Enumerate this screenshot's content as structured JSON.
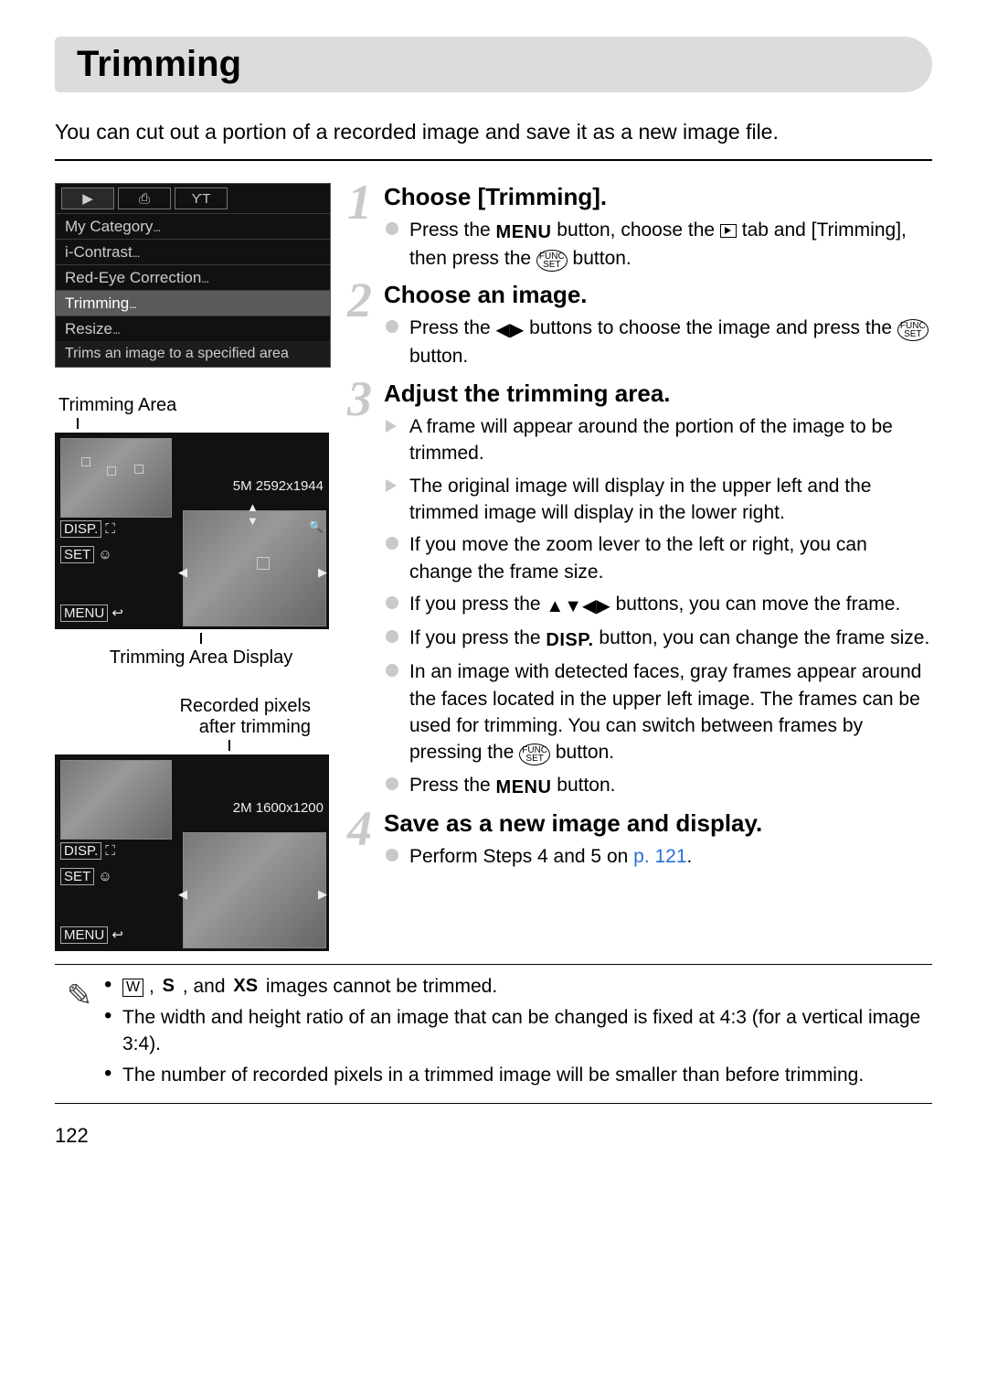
{
  "page": {
    "title": "Trimming",
    "intro": "You can cut out a portion of a recorded image and save it as a new image file.",
    "number": "122"
  },
  "lcd_menu": {
    "tabs": [
      "▶",
      "⎙",
      "ϒΤ"
    ],
    "active_tab": 0,
    "items": [
      {
        "label": "My Category",
        "selected": false
      },
      {
        "label": "i-Contrast",
        "selected": false
      },
      {
        "label": "Red-Eye Correction",
        "selected": false
      },
      {
        "label": "Trimming",
        "selected": true
      },
      {
        "label": "Resize",
        "selected": false
      }
    ],
    "hint": "Trims an image to a specified area"
  },
  "lcd_trim1": {
    "resolution": "5M 2592x1944",
    "label_above": "Trimming Area",
    "label_below": "Trimming Area Display"
  },
  "lcd_trim2": {
    "label_above_l1": "Recorded pixels",
    "label_above_l2": "after trimming",
    "resolution": "2M 1600x1200"
  },
  "lcd_buttons": {
    "disp": "DISP.",
    "set": "SET",
    "menu": "MENU"
  },
  "steps": [
    {
      "num": "1",
      "title": "Choose [Trimming].",
      "items": [
        {
          "type": "circle",
          "segments": [
            {
              "t": "Press the "
            },
            {
              "ico": "menu"
            },
            {
              "t": " button, choose the "
            },
            {
              "ico": "play"
            },
            {
              "t": " tab and [Trimming], then press the "
            },
            {
              "ico": "funcset"
            },
            {
              "t": " button."
            }
          ]
        }
      ]
    },
    {
      "num": "2",
      "title": "Choose an image.",
      "items": [
        {
          "type": "circle",
          "segments": [
            {
              "t": "Press the "
            },
            {
              "ico": "lr"
            },
            {
              "t": " buttons to choose the image and press the "
            },
            {
              "ico": "funcset"
            },
            {
              "t": " button."
            }
          ]
        }
      ]
    },
    {
      "num": "3",
      "title": "Adjust the trimming area.",
      "items": [
        {
          "type": "tri",
          "segments": [
            {
              "t": "A frame will appear around the portion of the image to be trimmed."
            }
          ]
        },
        {
          "type": "tri",
          "segments": [
            {
              "t": "The original image will display in the upper left and the trimmed image will display in the lower right."
            }
          ]
        },
        {
          "type": "circle",
          "segments": [
            {
              "t": "If you move the zoom lever to the left or right, you can change the frame size."
            }
          ]
        },
        {
          "type": "circle",
          "segments": [
            {
              "t": "If you press the "
            },
            {
              "ico": "udlr"
            },
            {
              "t": " buttons, you can move the frame."
            }
          ]
        },
        {
          "type": "circle",
          "segments": [
            {
              "t": "If you press the "
            },
            {
              "ico": "disp"
            },
            {
              "t": " button, you can change the frame size."
            }
          ]
        },
        {
          "type": "circle",
          "segments": [
            {
              "t": "In an image with detected faces, gray frames appear around the faces located in the upper left image. The frames can be used for trimming. You can switch between frames by pressing the "
            },
            {
              "ico": "funcset"
            },
            {
              "t": " button."
            }
          ]
        },
        {
          "type": "circle",
          "segments": [
            {
              "t": "Press the "
            },
            {
              "ico": "menu"
            },
            {
              "t": " button."
            }
          ]
        }
      ]
    },
    {
      "num": "4",
      "title": "Save as a new image and display.",
      "items": [
        {
          "type": "circle",
          "segments": [
            {
              "t": "Perform Steps 4 and 5 on "
            },
            {
              "link": "p. 121"
            },
            {
              "t": "."
            }
          ]
        }
      ]
    }
  ],
  "notes": {
    "items": [
      {
        "segments": [
          {
            "ico": "W"
          },
          {
            "t": " , "
          },
          {
            "ico": "S"
          },
          {
            "t": " , and "
          },
          {
            "ico": "XS"
          },
          {
            "t": " images cannot be trimmed."
          }
        ]
      },
      {
        "segments": [
          {
            "t": "The width and height ratio of an image that can be changed is fixed at 4:3 (for a vertical image 3:4)."
          }
        ]
      },
      {
        "segments": [
          {
            "t": "The number of recorded pixels in a trimmed image will be smaller than before trimming."
          }
        ]
      }
    ]
  }
}
